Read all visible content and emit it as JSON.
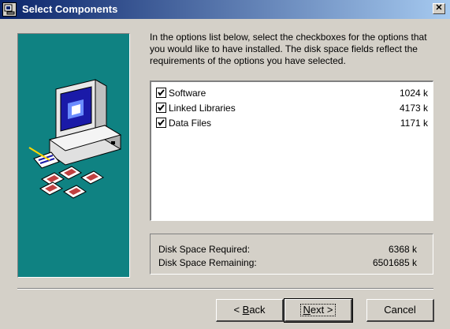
{
  "window": {
    "title": "Select Components",
    "close_glyph": "✕"
  },
  "intro_text": "In the options list below, select the checkboxes for the options that you would like to have installed.  The disk space fields reflect the requirements of the options you have selected.",
  "components": [
    {
      "label": "Software",
      "size": "1024 k",
      "checked": true
    },
    {
      "label": "Linked Libraries",
      "size": "4173 k",
      "checked": true
    },
    {
      "label": "Data Files",
      "size": "1171 k",
      "checked": true
    }
  ],
  "disk": {
    "required_label": "Disk Space Required:",
    "required_value": "6368 k",
    "remaining_label": "Disk Space Remaining:",
    "remaining_value": "6501685 k"
  },
  "buttons": {
    "back_prefix": "< ",
    "back_mnemonic": "B",
    "back_rest": "ack",
    "next_mnemonic": "N",
    "next_rest": "ext >",
    "cancel": "Cancel"
  },
  "colors": {
    "art_background": "#0f8282",
    "titlebar_start": "#0a246a",
    "titlebar_end": "#a6caf0",
    "dialog": "#d4d0c8"
  },
  "icons": {
    "art": "computer-with-disks-illustration",
    "title": "installer-icon"
  }
}
